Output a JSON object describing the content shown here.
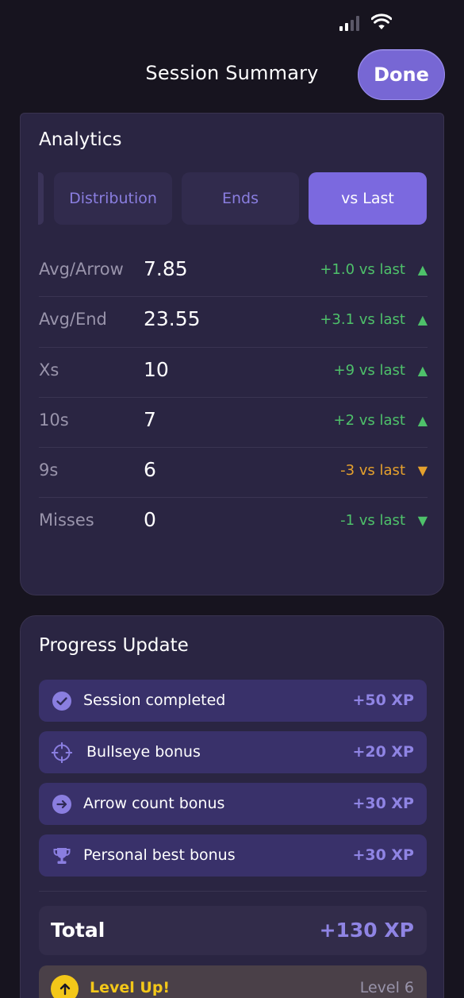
{
  "header": {
    "title": "Session Summary",
    "done_label": "Done"
  },
  "analytics": {
    "title": "Analytics",
    "tabs": [
      {
        "label": "Distribution",
        "active": false
      },
      {
        "label": "Ends",
        "active": false
      },
      {
        "label": "vs Last",
        "active": true
      }
    ],
    "stats": [
      {
        "label": "Avg/Arrow",
        "value": "7.85",
        "delta": "+1.0 vs last",
        "arrow": "▲",
        "trend": "up"
      },
      {
        "label": "Avg/End",
        "value": "23.55",
        "delta": "+3.1 vs last",
        "arrow": "▲",
        "trend": "up"
      },
      {
        "label": "Xs",
        "value": "10",
        "delta": "+9 vs last",
        "arrow": "▲",
        "trend": "up"
      },
      {
        "label": "10s",
        "value": "7",
        "delta": "+2 vs last",
        "arrow": "▲",
        "trend": "up"
      },
      {
        "label": "9s",
        "value": "6",
        "delta": "-3 vs last",
        "arrow": "▼",
        "trend": "down"
      },
      {
        "label": "Misses",
        "value": "0",
        "delta": "-1 vs last",
        "arrow": "▼",
        "trend": "good-down"
      }
    ]
  },
  "progress": {
    "title": "Progress Update",
    "items": [
      {
        "icon": "check-circle-icon",
        "label": "Session completed",
        "xp": "+50 XP"
      },
      {
        "icon": "crosshair-icon",
        "label": "Bullseye bonus",
        "xp": "+20 XP"
      },
      {
        "icon": "arrow-right-circle-icon",
        "label": "Arrow count bonus",
        "xp": "+30 XP"
      },
      {
        "icon": "trophy-icon",
        "label": "Personal best bonus",
        "xp": "+30 XP"
      }
    ],
    "total_label": "Total",
    "total_value": "+130 XP",
    "levelup_label": "Level Up!",
    "levelup_level": "Level 6"
  },
  "colors": {
    "accent": "#7b69df",
    "positive": "#4ec16a",
    "warning": "#e5a12d",
    "xp": "#8f84e4",
    "gold": "#f3c719"
  }
}
